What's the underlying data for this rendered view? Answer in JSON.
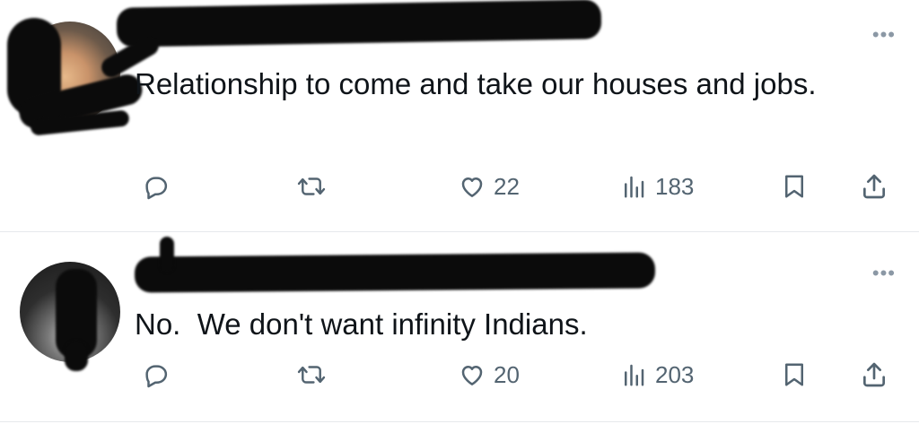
{
  "tweets": [
    {
      "text": "Relationship to come and take our houses and jobs.",
      "more_icon": "•••",
      "actions": {
        "likes": "22",
        "views": "183"
      }
    },
    {
      "text": "No.  We don't want infinity Indians.",
      "more_icon": "•••",
      "actions": {
        "likes": "20",
        "views": "203"
      }
    }
  ],
  "icons": [
    "reply-icon",
    "retweet-icon",
    "like-icon",
    "views-icon",
    "bookmark-icon",
    "share-icon",
    "more-icon"
  ],
  "colors": {
    "text": "#0f1419",
    "muted": "#536471",
    "divider": "#e6e9ec",
    "redaction": "#0b0b0b"
  }
}
